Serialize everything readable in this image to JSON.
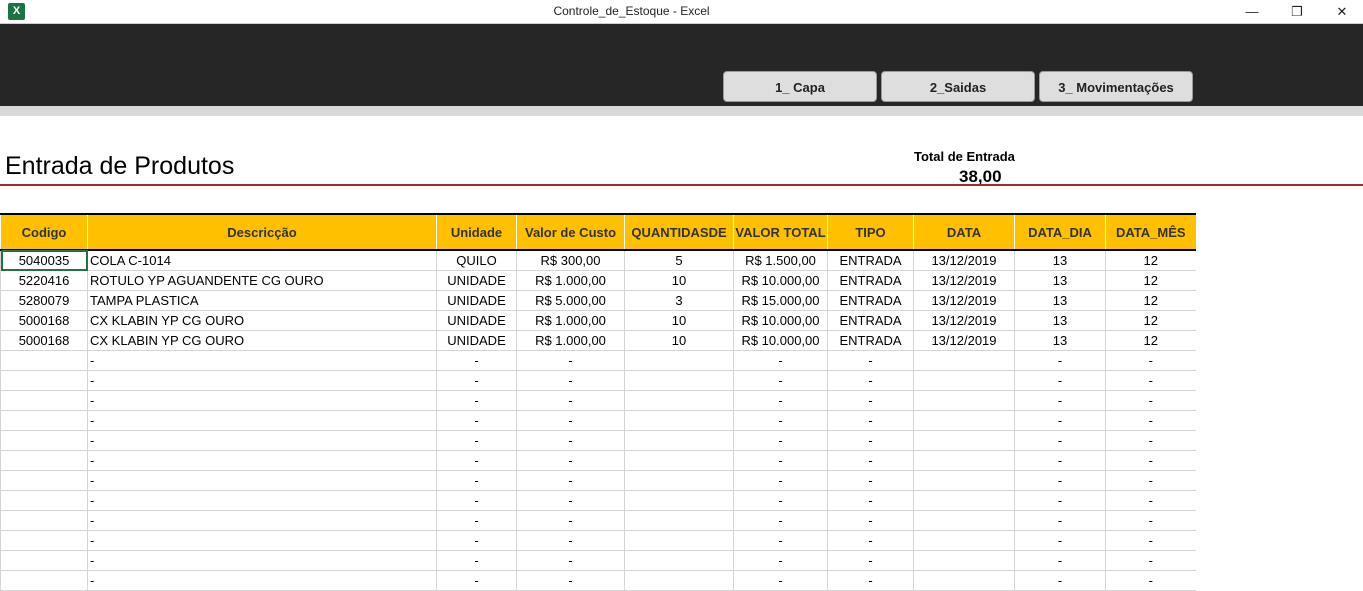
{
  "window": {
    "app_icon": "excel-icon",
    "app_icon_glyph": "X",
    "title": "Controle_de_Estoque - Excel",
    "minimize": "—",
    "restore": "❐",
    "close": "✕"
  },
  "nav": {
    "buttons": [
      "1_ Capa",
      "2_Saidas",
      "3_ Movimentações"
    ]
  },
  "page": {
    "title": "Entrada de Produtos",
    "total_label": "Total de Entrada",
    "total_value": "38,00"
  },
  "colors": {
    "header": "#ffc000",
    "accent_line": "#a52a2a",
    "banner": "#262626"
  },
  "table": {
    "headers": [
      "Codigo",
      "Descricção",
      "Unidade",
      "Valor de Custo",
      "QUANTIDASDE",
      "VALOR TOTAL",
      "TIPO",
      "DATA",
      "DATA_DIA",
      "DATA_MÊS"
    ],
    "rows": [
      [
        "5040035",
        "COLA C-1014",
        "QUILO",
        "R$ 300,00",
        "5",
        "R$ 1.500,00",
        "ENTRADA",
        "13/12/2019",
        "13",
        "12"
      ],
      [
        "5220416",
        "ROTULO YP AGUANDENTE CG OURO",
        "UNIDADE",
        "R$ 1.000,00",
        "10",
        "R$ 10.000,00",
        "ENTRADA",
        "13/12/2019",
        "13",
        "12"
      ],
      [
        "5280079",
        "TAMPA PLASTICA",
        "UNIDADE",
        "R$ 5.000,00",
        "3",
        "R$ 15.000,00",
        "ENTRADA",
        "13/12/2019",
        "13",
        "12"
      ],
      [
        "5000168",
        "CX  KLABIN YP CG OURO",
        "UNIDADE",
        "R$ 1.000,00",
        "10",
        "R$ 10.000,00",
        "ENTRADA",
        "13/12/2019",
        "13",
        "12"
      ],
      [
        "5000168",
        "CX  KLABIN YP CG OURO",
        "UNIDADE",
        "R$ 1.000,00",
        "10",
        "R$ 10.000,00",
        "ENTRADA",
        "13/12/2019",
        "13",
        "12"
      ],
      [
        "",
        "-",
        "-",
        "-",
        "",
        "-",
        "-",
        "",
        "-",
        "-"
      ],
      [
        "",
        "-",
        "-",
        "-",
        "",
        "-",
        "-",
        "",
        "-",
        "-"
      ],
      [
        "",
        "-",
        "-",
        "-",
        "",
        "-",
        "-",
        "",
        "-",
        "-"
      ],
      [
        "",
        "-",
        "-",
        "-",
        "",
        "-",
        "-",
        "",
        "-",
        "-"
      ],
      [
        "",
        "-",
        "-",
        "-",
        "",
        "-",
        "-",
        "",
        "-",
        "-"
      ],
      [
        "",
        "-",
        "-",
        "-",
        "",
        "-",
        "-",
        "",
        "-",
        "-"
      ],
      [
        "",
        "-",
        "-",
        "-",
        "",
        "-",
        "-",
        "",
        "-",
        "-"
      ],
      [
        "",
        "-",
        "-",
        "-",
        "",
        "-",
        "-",
        "",
        "-",
        "-"
      ],
      [
        "",
        "-",
        "-",
        "-",
        "",
        "-",
        "-",
        "",
        "-",
        "-"
      ],
      [
        "",
        "-",
        "-",
        "-",
        "",
        "-",
        "-",
        "",
        "-",
        "-"
      ],
      [
        "",
        "-",
        "-",
        "-",
        "",
        "-",
        "-",
        "",
        "-",
        "-"
      ],
      [
        "",
        "-",
        "-",
        "-",
        "",
        "-",
        "-",
        "",
        "-",
        "-"
      ]
    ]
  }
}
